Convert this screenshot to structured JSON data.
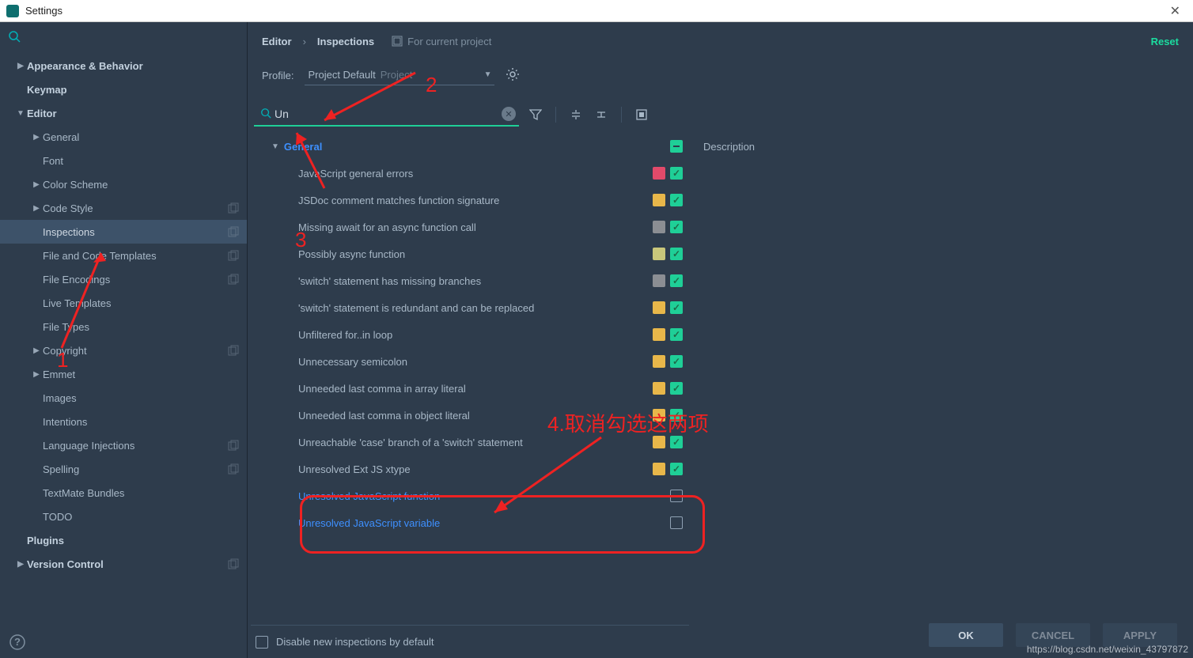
{
  "window": {
    "title": "Settings"
  },
  "sidebar": {
    "items": [
      {
        "label": "Appearance & Behavior",
        "bold": true,
        "ind": 0,
        "arrow": "closed"
      },
      {
        "label": "Keymap",
        "bold": true,
        "ind": 0
      },
      {
        "label": "Editor",
        "bold": true,
        "ind": 0,
        "arrow": "open"
      },
      {
        "label": "General",
        "ind": 1,
        "arrow": "closed"
      },
      {
        "label": "Font",
        "ind": 1
      },
      {
        "label": "Color Scheme",
        "ind": 1,
        "arrow": "closed"
      },
      {
        "label": "Code Style",
        "ind": 1,
        "arrow": "closed",
        "copy": true
      },
      {
        "label": "Inspections",
        "ind": 1,
        "selected": true,
        "copy": true
      },
      {
        "label": "File and Code Templates",
        "ind": 1,
        "copy": true
      },
      {
        "label": "File Encodings",
        "ind": 1,
        "copy": true
      },
      {
        "label": "Live Templates",
        "ind": 1
      },
      {
        "label": "File Types",
        "ind": 1
      },
      {
        "label": "Copyright",
        "ind": 1,
        "arrow": "closed",
        "copy": true
      },
      {
        "label": "Emmet",
        "ind": 1,
        "arrow": "closed"
      },
      {
        "label": "Images",
        "ind": 1
      },
      {
        "label": "Intentions",
        "ind": 1
      },
      {
        "label": "Language Injections",
        "ind": 1,
        "copy": true
      },
      {
        "label": "Spelling",
        "ind": 1,
        "copy": true
      },
      {
        "label": "TextMate Bundles",
        "ind": 1
      },
      {
        "label": "TODO",
        "ind": 1
      },
      {
        "label": "Plugins",
        "bold": true,
        "ind": 0
      },
      {
        "label": "Version Control",
        "bold": true,
        "ind": 0,
        "arrow": "closed",
        "copy": true
      }
    ]
  },
  "breadcrumb": {
    "a": "Editor",
    "b": "Inspections",
    "for_project": "For current project",
    "reset": "Reset"
  },
  "profile": {
    "label": "Profile:",
    "value": "Project Default",
    "suffix": "Project"
  },
  "search": {
    "value": "Un"
  },
  "inspections": {
    "group": "General",
    "items": [
      {
        "label": "JavaScript general errors",
        "sev": "#e24a6a",
        "chk": true
      },
      {
        "label": "JSDoc comment matches function signature",
        "sev": "#e8b74a",
        "chk": true
      },
      {
        "label": "Missing await for an async function call",
        "sev": "#8b8e93",
        "chk": true
      },
      {
        "label": "Possibly async function",
        "sev": "#c9c77b",
        "chk": true
      },
      {
        "label": "'switch' statement has missing branches",
        "sev": "#8b8e93",
        "chk": true
      },
      {
        "label": "'switch' statement is redundant and can be replaced",
        "sev": "#e8b74a",
        "chk": true
      },
      {
        "label": "Unfiltered for..in loop",
        "sev": "#e8b74a",
        "chk": true
      },
      {
        "label": "Unnecessary semicolon",
        "sev": "#e8b74a",
        "chk": true
      },
      {
        "label": "Unneeded last comma in array literal",
        "sev": "#e8b74a",
        "chk": true
      },
      {
        "label": "Unneeded last comma in object literal",
        "sev": "#e8b74a",
        "chk": true
      },
      {
        "label": "Unreachable 'case' branch of a 'switch' statement",
        "sev": "#e8b74a",
        "chk": true
      },
      {
        "label": "Unresolved Ext JS xtype",
        "sev": "#e8b74a",
        "chk": true
      },
      {
        "label": "Unresolved JavaScript function",
        "sev": "",
        "chk": false,
        "link": true
      },
      {
        "label": "Unresolved JavaScript variable",
        "sev": "",
        "chk": false,
        "link": true
      }
    ],
    "disable_label": "Disable new inspections by default"
  },
  "desc": {
    "title": "Description"
  },
  "buttons": {
    "ok": "OK",
    "cancel": "CANCEL",
    "apply": "APPLY"
  },
  "annotations": {
    "n1": "1",
    "n2": "2",
    "n3": "3",
    "n4": "4.取消勾选这两项"
  },
  "watermark": "https://blog.csdn.net/weixin_43797872"
}
